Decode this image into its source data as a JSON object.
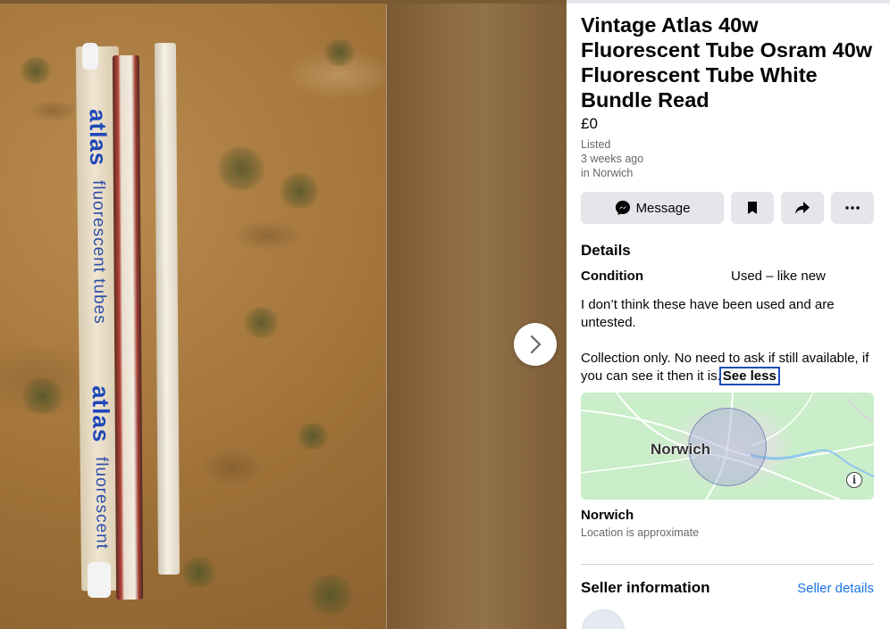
{
  "listing": {
    "title": "Vintage Atlas 40w Fluorescent Tube Osram 40w Fluorescent Tube White Bundle Read",
    "price": "£0",
    "listed_label": "Listed",
    "listed_time": "3 weeks ago",
    "listed_location": "in Norwich"
  },
  "actions": {
    "message_label": "Message",
    "icons": [
      "messenger-icon",
      "bookmark-icon",
      "share-icon",
      "more-icon"
    ]
  },
  "details": {
    "heading": "Details",
    "condition_label": "Condition",
    "condition_value": "Used – like new",
    "description_p1": "I don’t think these have been used and are untested.",
    "description_p2": "Collection only. No need to ask if still available, if you can see it then it is.",
    "see_less_label": "See less"
  },
  "map": {
    "label": "Norwich",
    "info_symbol": "i",
    "location_name": "Norwich",
    "location_note": "Location is approximate"
  },
  "seller": {
    "heading": "Seller information",
    "details_link": "Seller details"
  },
  "photo": {
    "box_text_1": "atlas",
    "box_text_2": "fluorescent tubes",
    "box_text_3": "atlas",
    "box_text_4": "fluorescent"
  },
  "colors": {
    "accent_link": "#1b74e4",
    "button_bg": "#e4e6eb",
    "muted_text": "#65676b",
    "map_green": "#c9eec9"
  }
}
